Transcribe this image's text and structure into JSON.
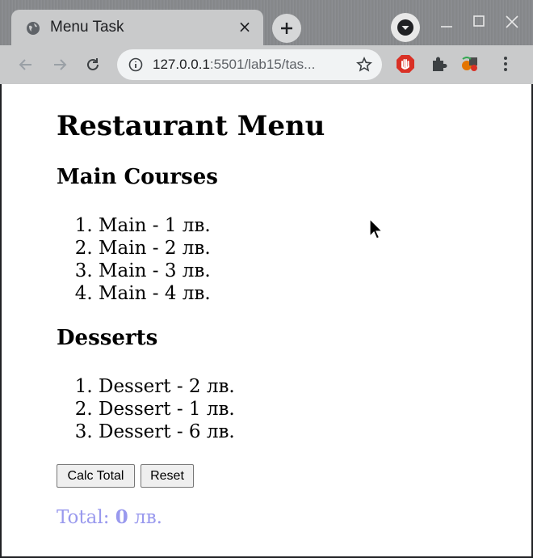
{
  "browser": {
    "tab_title": "Menu Task",
    "tab_close_glyph": "×",
    "new_tab_glyph": "+",
    "url_host": "127.0.0.1",
    "url_path": ":5501/lab15/tas..."
  },
  "page": {
    "title": "Restaurant Menu",
    "sections": [
      {
        "heading": "Main Courses",
        "items": [
          "Main - 1 лв.",
          "Main - 2 лв.",
          "Main - 3 лв.",
          "Main - 4 лв."
        ]
      },
      {
        "heading": "Desserts",
        "items": [
          "Dessert - 2 лв.",
          "Dessert - 1 лв.",
          "Dessert - 6 лв."
        ]
      }
    ],
    "buttons": {
      "calc": "Calc Total",
      "reset": "Reset"
    },
    "total": {
      "label": "Total:",
      "value": "0",
      "currency": "лв."
    }
  },
  "colors": {
    "total_text": "#9999ee",
    "accent_red": "#d93025"
  }
}
